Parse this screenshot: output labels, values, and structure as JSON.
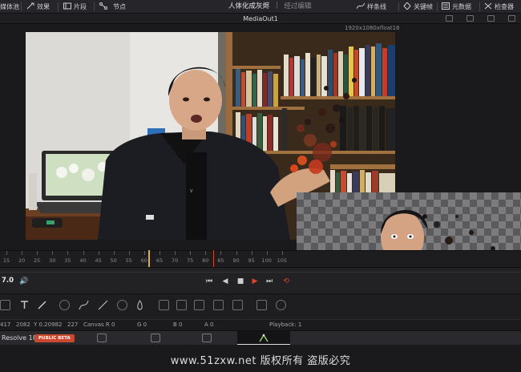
{
  "topbar": {
    "media_pool": "媒体池",
    "effects": "效果",
    "clips": "片段",
    "nodes": "节点",
    "project_title": "人体化成灰烬",
    "edited": "经过编辑",
    "spline": "样条线",
    "keyframes": "关键帧",
    "metadata": "元数据",
    "inspector": "检查器"
  },
  "viewer": {
    "title": "MediaOut1",
    "resolution": "1920x1080xfloat16"
  },
  "ruler": {
    "ticks": [
      "15",
      "20",
      "25",
      "30",
      "35",
      "40",
      "45",
      "50",
      "55",
      "60",
      "65",
      "70",
      "75",
      "80",
      "85",
      "90",
      "95",
      "100",
      "105"
    ]
  },
  "transport": {
    "frame": "7.0"
  },
  "status": {
    "coord_x": "417",
    "coord_y": "2082",
    "y_value": "Y 0.20982",
    "value_227": "227",
    "canvas": "Canvas R 0",
    "g": "G 0",
    "b": "B 0",
    "a": "A 0",
    "playback": "Playback: 1"
  },
  "pagebar": {
    "app_name": "Resolve 18",
    "beta": "PUBLIC BETA"
  },
  "watermark": "www.51zxw.net 版权所有 盗版必究",
  "colors": {
    "accent_red": "#d2462d",
    "playhead": "#d8b14a",
    "beta_badge": "#c9482f"
  }
}
